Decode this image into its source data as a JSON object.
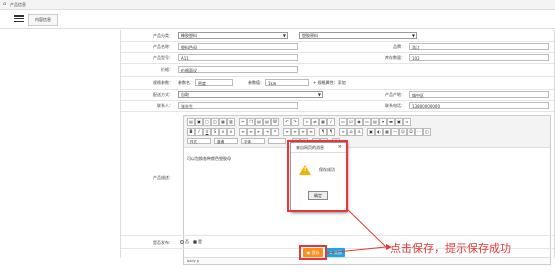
{
  "breadcrumb": "产品信息",
  "tab_label": "内容信息",
  "fields": {
    "category_label": "产品分类：",
    "category_value": "橡胶塑料",
    "subcategory_value": "塑胶原料",
    "name_label": "产品名称：",
    "name_value": "塑料色母",
    "brand_label": "品牌：",
    "brand_value": "浩江",
    "model_label": "产品型号：",
    "model_value": "A11",
    "stock_label": "库存数量：",
    "stock_value": "102",
    "price_label": "价格：",
    "price_value": "价格面议",
    "spec_label": "规格参数：",
    "spec_name_label": "参数名：",
    "spec_name_value": "密度",
    "spec_value_label": "参数值：",
    "spec_value_value": "1kw",
    "spec_add": "+ 规格属性：添加",
    "delivery_label": "配送方式：",
    "delivery_value": "自取",
    "origin_label": "产品产地：",
    "origin_value": "城中区",
    "contact_label": "联系人：",
    "contact_value": "张先生",
    "phone_label": "联系电话：",
    "phone_value": "13800000000",
    "desc_label": "产品描述：",
    "publish_label": "是否发布：",
    "publish_no": "否",
    "publish_yes": "是"
  },
  "editor": {
    "combo1": "样式",
    "combo2": "普通",
    "combo3": "字体",
    "content": "可以包换各种颜色塑胶母",
    "status": "body  p"
  },
  "dialog": {
    "title": "来自网页的消息",
    "message": "保存成功",
    "ok_label": "确定"
  },
  "buttons": {
    "save": "保存",
    "close": "关闭"
  },
  "annotation": "点击保存，提示保存成功",
  "colors": {
    "highlight": "#e23a3a",
    "save": "#ff8c1a",
    "close": "#19a7e0"
  }
}
